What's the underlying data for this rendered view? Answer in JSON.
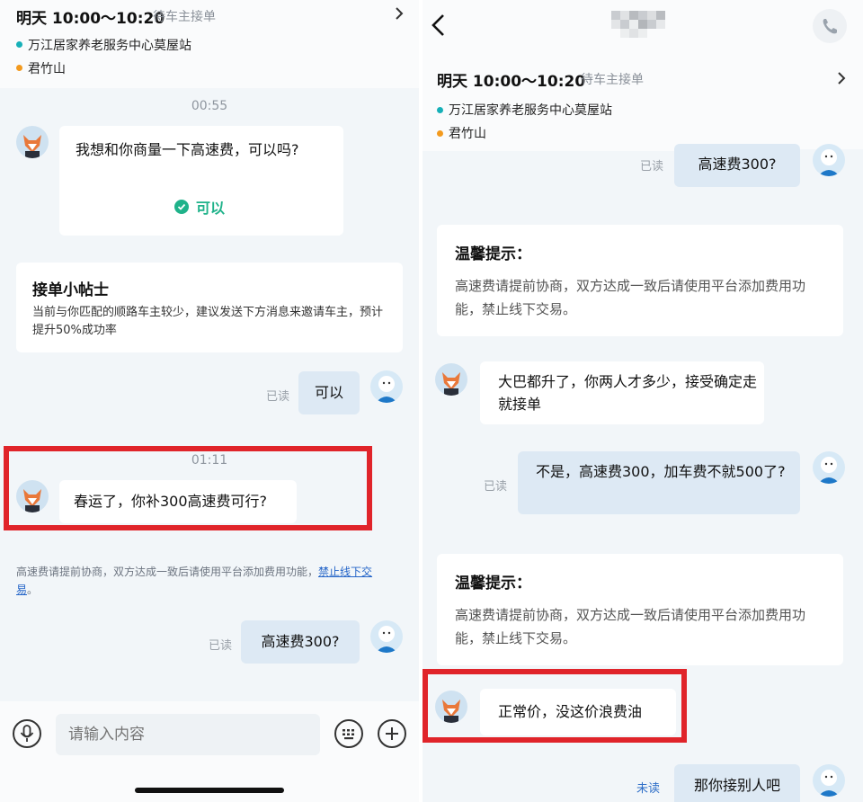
{
  "trip": {
    "time": "明天 10:00～10:20",
    "status": "待车主接单",
    "origin": "万江居家养老服务中心莫屋站",
    "destination": "君竹山"
  },
  "colors": {
    "origin_dot": "#16b0b8",
    "destination_dot": "#f39a1e",
    "highlight_box": "#e0242a",
    "accept_green": "#1fb28a",
    "link_blue": "#2565c8"
  },
  "left": {
    "timestamp1": "00:55",
    "msg_driver1": "我想和你商量一下高速费，可以吗?",
    "accept_option": "可以",
    "tip_title": "接单小帖士",
    "tip_body": "当前与你匹配的顺路车主较少，建议发送下方消息来邀请车主，预计提升50%成功率",
    "read_label1": "已读",
    "msg_me1": "可以",
    "timestamp2": "01:11",
    "msg_driver2": "春运了，你补300高速费可行?",
    "notice_text": "高速费请提前协商，双方达成一致后请使用平台添加费用功能，",
    "notice_link": "禁止线下交易",
    "notice_end": "。",
    "read_label2": "已读",
    "msg_me2": "高速费300?",
    "input_placeholder": "请输入内容"
  },
  "right": {
    "read_label0": "已读",
    "msg_me0": "高速费300?",
    "tip1_title": "温馨提示：",
    "tip1_body": "高速费请提前协商，双方达成一致后请使用平台添加费用功能，禁止线下交易。",
    "msg_driver1": "大巴都升了，你两人才多少，接受确定走就接单",
    "read_label1": "已读",
    "msg_me1": "不是，高速费300，加车费不就500了?",
    "tip2_title": "温馨提示：",
    "tip2_body": "高速费请提前协商，双方达成一致后请使用平台添加费用功能，禁止线下交易。",
    "msg_driver2": "正常价，没这价浪费油",
    "unread_label": "未读",
    "msg_me2": "那你接别人吧"
  },
  "icons": {
    "back": "back-chevron-icon",
    "phone": "phone-icon",
    "voice": "microphone-icon",
    "keyboard": "keyboard-icon",
    "add": "plus-icon",
    "check": "check-circle-icon",
    "chevron": "chevron-right-icon"
  }
}
